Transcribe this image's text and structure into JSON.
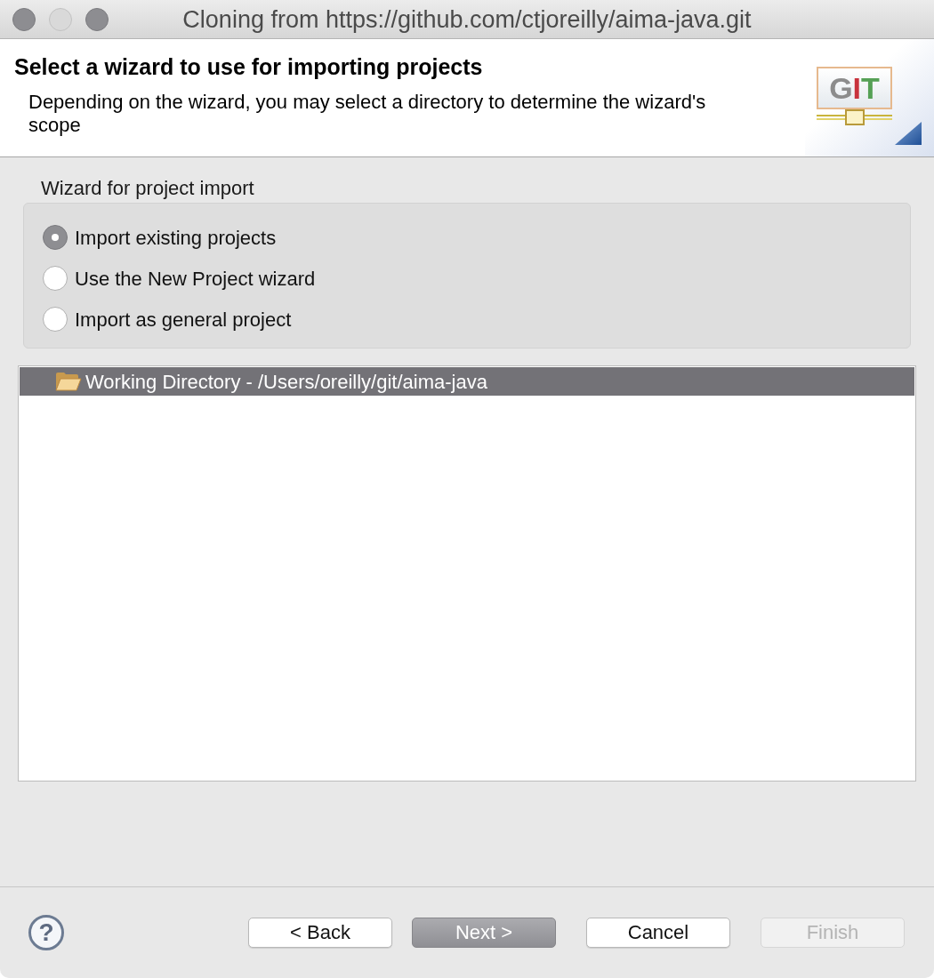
{
  "window": {
    "title": "Cloning from https://github.com/ctjoreilly/aima-java.git"
  },
  "banner": {
    "title": "Select a wizard to use for importing projects",
    "description": "Depending on the wizard, you may select a directory to determine the wizard's scope",
    "logo": [
      {
        "char": "G",
        "color": "#8c8c8c"
      },
      {
        "char": "I",
        "color": "#c8323c"
      },
      {
        "char": "T",
        "color": "#55a055"
      }
    ]
  },
  "wizard_group": {
    "label": "Wizard for project import",
    "options": [
      {
        "label": "Import existing projects",
        "selected": true
      },
      {
        "label": "Use the New Project wizard",
        "selected": false
      },
      {
        "label": "Import as general project",
        "selected": false
      }
    ]
  },
  "tree": {
    "items": [
      {
        "label": "Working Directory - /Users/oreilly/git/aima-java",
        "selected": true
      }
    ]
  },
  "buttons": [
    {
      "kind": "help",
      "label": "?"
    },
    {
      "kind": "push",
      "label": "< Back",
      "default": false,
      "disabled": false
    },
    {
      "kind": "push",
      "label": "Next >",
      "default": true,
      "disabled": false
    },
    {
      "kind": "push",
      "label": "Cancel",
      "default": false,
      "disabled": false
    },
    {
      "kind": "push",
      "label": "Finish",
      "default": false,
      "disabled": true
    }
  ]
}
